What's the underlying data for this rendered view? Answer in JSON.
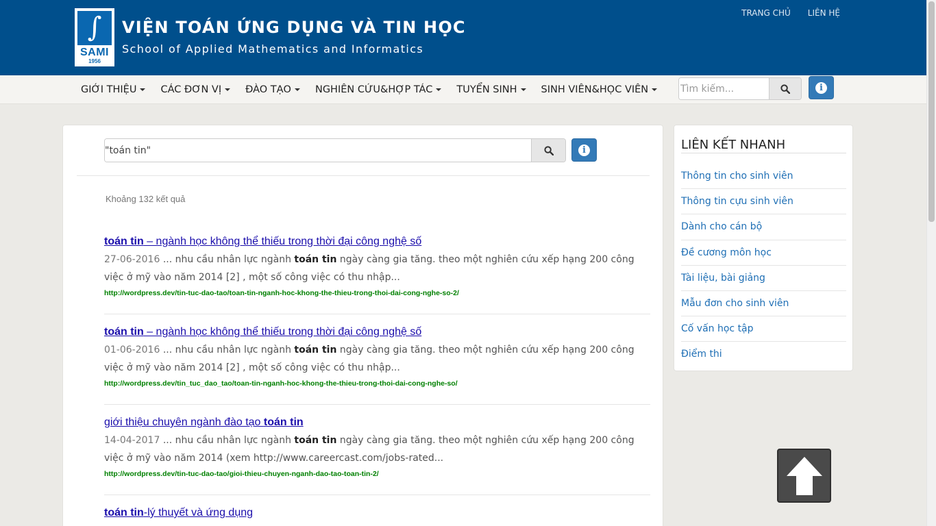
{
  "header": {
    "logo_text": "SAMI",
    "logo_year": "1956",
    "title": "VIỆN TOÁN ỨNG DỤNG VÀ TIN HỌC",
    "subtitle": "School of Applied Mathematics and Informatics",
    "links": [
      "TRANG CHỦ",
      "LIÊN HỆ"
    ]
  },
  "nav": {
    "items": [
      "GIỚI THIỆU",
      "CÁC ĐƠN VỊ",
      "ĐÀO TẠO",
      "NGHIÊN CỨU&HỢP TÁC",
      "TUYỂN SINH",
      "SINH VIÊN&HỌC VIÊN"
    ],
    "search_placeholder": "Tìm kiếm..."
  },
  "search": {
    "query": "\"toán tin\"",
    "result_count": "Khoảng 132 kết quả"
  },
  "results": [
    {
      "title_bold": "toán tin",
      "title_rest": " – ngành học không thể thiếu trong thời đại công nghệ số",
      "date": "27-06-2016",
      "snippet_pre": " ... nhu cầu nhân lực ngành ",
      "snippet_bold": "toán tin",
      "snippet_post": " ngày càng gia tăng. theo một nghiên cứu xếp hạng 200 công việc ở mỹ vào năm 2014 [2] , một  số công việc có thu nhập...",
      "url": "http://wordpress.dev/tin-tuc-dao-tao/toan-tin-nganh-hoc-khong-the-thieu-trong-thoi-dai-cong-nghe-so-2/"
    },
    {
      "title_bold": "toán tin",
      "title_rest": " – ngành học không thể thiếu trong thời đại công nghệ số",
      "date": "01-06-2016",
      "snippet_pre": " ... nhu cầu nhân lực ngành ",
      "snippet_bold": "toán tin",
      "snippet_post": " ngày càng gia tăng. theo một nghiên cứu xếp hạng 200 công việc ở mỹ vào năm 2014 [2] , một  số công việc có thu nhập...",
      "url": "http://wordpress.dev/tin_tuc_dao_tao/toan-tin-nganh-hoc-khong-the-thieu-trong-thoi-dai-cong-nghe-so/"
    },
    {
      "title_pre": "giới thiệu chuyên ngành đào tạo ",
      "title_bold": "toán tin",
      "date": "14-04-2017",
      "snippet_pre": " ... nhu cầu nhân lực ngành ",
      "snippet_bold": "toán tin",
      "snippet_post": " ngày càng gia tăng.  theo một nghiên cứu xếp hạng 200 công việc ở mỹ vào năm  2014 (xem http://www.careercast.com/jobs-rated...",
      "url": "http://wordpress.dev/tin-tuc-dao-tao/gioi-thieu-chuyen-nganh-dao-tao-toan-tin-2/"
    },
    {
      "title_bold": "toán tin",
      "title_rest": "-lý thuyết và ứng dụng"
    }
  ],
  "sidebar": {
    "title": "LIÊN KẾT NHANH",
    "links": [
      "Thông tin cho sinh viên",
      "Thông tin cựu sinh viên",
      "Dành cho cán bộ",
      "Đề cương môn học",
      "Tài liệu, bài giảng",
      "Mẫu đơn cho sinh viên",
      "Cố vấn học tập",
      "Điểm thi"
    ]
  },
  "icons": {
    "search": "search-icon",
    "info": "info-icon",
    "back_to_top": "arrow-up-icon"
  },
  "colors": {
    "header_bg": "#004f8c",
    "link_blue": "#1a0dab",
    "url_green": "#008000",
    "accent_button": "#337ab7"
  }
}
